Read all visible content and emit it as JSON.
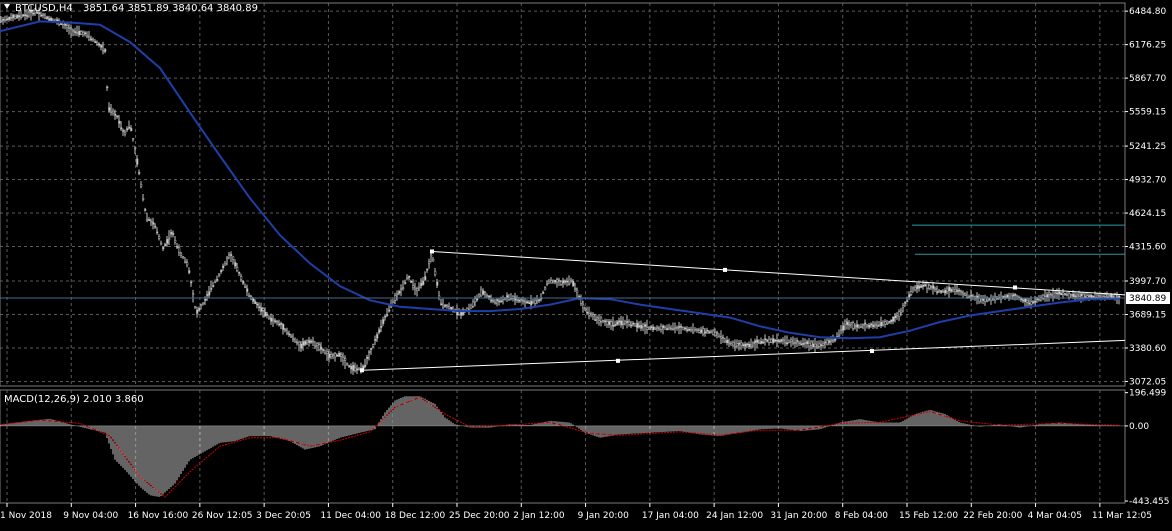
{
  "chart_data": [
    {
      "type": "candlestick",
      "title": "BTCUSD,H4",
      "ohlc_readout": "3851.64 3851.89 3840.64 3840.89",
      "symbol": "BTCUSD",
      "timeframe": "H4",
      "current_price": 3840.89,
      "current_price_label": "3840.89",
      "y_ticks": [
        "6484.80",
        "6176.25",
        "5867.70",
        "5559.15",
        "5241.25",
        "4932.70",
        "4624.15",
        "4315.60",
        "3997.70",
        "3689.15",
        "3380.60",
        "3072.05"
      ],
      "ylim": [
        3030,
        6560
      ],
      "x_ticks": [
        "1 Nov 2018",
        "9 Nov 04:00",
        "16 Nov 16:00",
        "26 Nov 12:05",
        "3 Dec 20:05",
        "11 Dec 04:00",
        "18 Dec 12:00",
        "25 Dec 20:00",
        "2 Jan 12:00",
        "9 Jan 20:00",
        "17 Jan 04:00",
        "24 Jan 12:00",
        "31 Jan 20:00",
        "8 Feb 04:00",
        "15 Feb 12:00",
        "22 Feb 20:00",
        "4 Mar 04:05",
        "11 Mar 12:05"
      ],
      "grid": true,
      "price_path": [
        [
          0,
          6400
        ],
        [
          20,
          6440
        ],
        [
          36,
          6480
        ],
        [
          48,
          6420
        ],
        [
          60,
          6380
        ],
        [
          72,
          6300
        ],
        [
          84,
          6280
        ],
        [
          96,
          6200
        ],
        [
          105,
          6120
        ],
        [
          108,
          5600
        ],
        [
          118,
          5500
        ],
        [
          124,
          5350
        ],
        [
          130,
          5450
        ],
        [
          138,
          5050
        ],
        [
          146,
          4600
        ],
        [
          155,
          4500
        ],
        [
          163,
          4300
        ],
        [
          172,
          4450
        ],
        [
          180,
          4250
        ],
        [
          188,
          4150
        ],
        [
          196,
          3700
        ],
        [
          204,
          3800
        ],
        [
          212,
          3950
        ],
        [
          222,
          4100
        ],
        [
          230,
          4250
        ],
        [
          240,
          4050
        ],
        [
          250,
          3850
        ],
        [
          260,
          3750
        ],
        [
          270,
          3650
        ],
        [
          280,
          3600
        ],
        [
          290,
          3500
        ],
        [
          300,
          3400
        ],
        [
          310,
          3450
        ],
        [
          320,
          3380
        ],
        [
          330,
          3300
        ],
        [
          340,
          3320
        ],
        [
          350,
          3200
        ],
        [
          362,
          3180
        ],
        [
          372,
          3380
        ],
        [
          382,
          3600
        ],
        [
          392,
          3800
        ],
        [
          400,
          3900
        ],
        [
          408,
          4050
        ],
        [
          416,
          3900
        ],
        [
          424,
          4000
        ],
        [
          432,
          4250
        ],
        [
          440,
          3800
        ],
        [
          450,
          3750
        ],
        [
          460,
          3700
        ],
        [
          470,
          3750
        ],
        [
          482,
          3900
        ],
        [
          495,
          3800
        ],
        [
          510,
          3850
        ],
        [
          525,
          3800
        ],
        [
          540,
          3820
        ],
        [
          548,
          4000
        ],
        [
          560,
          3980
        ],
        [
          572,
          4000
        ],
        [
          584,
          3750
        ],
        [
          596,
          3650
        ],
        [
          610,
          3600
        ],
        [
          625,
          3620
        ],
        [
          640,
          3580
        ],
        [
          655,
          3560
        ],
        [
          670,
          3570
        ],
        [
          685,
          3560
        ],
        [
          700,
          3540
        ],
        [
          715,
          3520
        ],
        [
          730,
          3420
        ],
        [
          745,
          3400
        ],
        [
          760,
          3440
        ],
        [
          775,
          3450
        ],
        [
          790,
          3440
        ],
        [
          805,
          3420
        ],
        [
          820,
          3410
        ],
        [
          835,
          3460
        ],
        [
          845,
          3600
        ],
        [
          860,
          3580
        ],
        [
          875,
          3590
        ],
        [
          890,
          3620
        ],
        [
          900,
          3700
        ],
        [
          912,
          3920
        ],
        [
          925,
          3960
        ],
        [
          940,
          3900
        ],
        [
          955,
          3920
        ],
        [
          968,
          3860
        ],
        [
          985,
          3820
        ],
        [
          1000,
          3850
        ],
        [
          1015,
          3860
        ],
        [
          1030,
          3790
        ],
        [
          1045,
          3860
        ],
        [
          1060,
          3880
        ],
        [
          1075,
          3860
        ],
        [
          1095,
          3850
        ],
        [
          1110,
          3860
        ],
        [
          1120,
          3840.89
        ]
      ],
      "ma_path": [
        [
          0,
          6300
        ],
        [
          40,
          6390
        ],
        [
          70,
          6380
        ],
        [
          100,
          6360
        ],
        [
          130,
          6200
        ],
        [
          160,
          5960
        ],
        [
          190,
          5550
        ],
        [
          220,
          5150
        ],
        [
          250,
          4760
        ],
        [
          280,
          4420
        ],
        [
          310,
          4160
        ],
        [
          340,
          3950
        ],
        [
          370,
          3820
        ],
        [
          400,
          3760
        ],
        [
          430,
          3740
        ],
        [
          460,
          3720
        ],
        [
          490,
          3720
        ],
        [
          520,
          3740
        ],
        [
          550,
          3780
        ],
        [
          580,
          3840
        ],
        [
          610,
          3830
        ],
        [
          640,
          3780
        ],
        [
          670,
          3740
        ],
        [
          700,
          3700
        ],
        [
          730,
          3660
        ],
        [
          760,
          3580
        ],
        [
          790,
          3520
        ],
        [
          820,
          3480
        ],
        [
          850,
          3470
        ],
        [
          880,
          3480
        ],
        [
          910,
          3540
        ],
        [
          940,
          3620
        ],
        [
          970,
          3680
        ],
        [
          1000,
          3720
        ],
        [
          1030,
          3760
        ],
        [
          1060,
          3800
        ],
        [
          1090,
          3830
        ],
        [
          1120,
          3835
        ]
      ],
      "trendlines": [
        {
          "name": "upper-trendline",
          "from": [
            432,
            4270
          ],
          "to": [
            1125,
            3870
          ],
          "handles": [
            [
              725,
              4100
            ],
            [
              1015,
              3938
            ]
          ]
        },
        {
          "name": "lower-trendline",
          "from": [
            362,
            3175
          ],
          "to": [
            1125,
            3450
          ],
          "handles": [
            [
              618,
              3262
            ],
            [
              872,
              3352
            ]
          ]
        }
      ],
      "horizontal_levels": [
        {
          "name": "level-line-upper",
          "price": 4513,
          "x_start": 912
        },
        {
          "name": "level-line-lower",
          "price": 4244,
          "x_start": 915
        }
      ],
      "colors": {
        "background": "#000000",
        "grid": "#5a5a5a",
        "candles": "#c8c8c8",
        "moving_average": "#1f3fa8",
        "trendline": "#ffffff",
        "level_line": "#2a9aa0",
        "price_line": "#4a6a8a",
        "axis_text": "#ffffff"
      }
    },
    {
      "type": "histogram",
      "title": "MACD(12,26,9) 2.010 3.860",
      "indicator": "MACD",
      "parameters": [
        12,
        26,
        9
      ],
      "macd_value": 2.01,
      "signal_value": 3.86,
      "y_ticks": [
        "196.499",
        "0.00",
        "-443.455"
      ],
      "ylim": [
        -455,
        212
      ],
      "macd_path": [
        [
          0,
          8
        ],
        [
          30,
          30
        ],
        [
          50,
          42
        ],
        [
          70,
          10
        ],
        [
          90,
          -20
        ],
        [
          105,
          -40
        ],
        [
          115,
          -200
        ],
        [
          125,
          -260
        ],
        [
          140,
          -360
        ],
        [
          150,
          -410
        ],
        [
          160,
          -420
        ],
        [
          175,
          -340
        ],
        [
          190,
          -200
        ],
        [
          205,
          -150
        ],
        [
          220,
          -100
        ],
        [
          235,
          -90
        ],
        [
          250,
          -60
        ],
        [
          270,
          -60
        ],
        [
          290,
          -90
        ],
        [
          305,
          -140
        ],
        [
          320,
          -120
        ],
        [
          340,
          -70
        ],
        [
          360,
          -40
        ],
        [
          375,
          -20
        ],
        [
          385,
          80
        ],
        [
          395,
          150
        ],
        [
          405,
          175
        ],
        [
          420,
          175
        ],
        [
          435,
          130
        ],
        [
          445,
          50
        ],
        [
          455,
          10
        ],
        [
          470,
          -10
        ],
        [
          490,
          -10
        ],
        [
          510,
          10
        ],
        [
          530,
          5
        ],
        [
          550,
          30
        ],
        [
          570,
          20
        ],
        [
          585,
          -40
        ],
        [
          600,
          -70
        ],
        [
          620,
          -50
        ],
        [
          650,
          -40
        ],
        [
          680,
          -30
        ],
        [
          700,
          -50
        ],
        [
          720,
          -60
        ],
        [
          740,
          -40
        ],
        [
          760,
          -20
        ],
        [
          780,
          -15
        ],
        [
          800,
          -30
        ],
        [
          820,
          -20
        ],
        [
          840,
          20
        ],
        [
          860,
          40
        ],
        [
          880,
          20
        ],
        [
          900,
          20
        ],
        [
          915,
          70
        ],
        [
          930,
          95
        ],
        [
          945,
          70
        ],
        [
          960,
          20
        ],
        [
          980,
          -5
        ],
        [
          1000,
          10
        ],
        [
          1020,
          -10
        ],
        [
          1040,
          10
        ],
        [
          1060,
          20
        ],
        [
          1080,
          10
        ],
        [
          1100,
          4
        ],
        [
          1120,
          2
        ]
      ],
      "signal_path": [
        [
          0,
          8
        ],
        [
          40,
          35
        ],
        [
          80,
          15
        ],
        [
          110,
          -60
        ],
        [
          140,
          -300
        ],
        [
          165,
          -420
        ],
        [
          190,
          -270
        ],
        [
          220,
          -120
        ],
        [
          250,
          -70
        ],
        [
          280,
          -70
        ],
        [
          310,
          -120
        ],
        [
          340,
          -85
        ],
        [
          370,
          -35
        ],
        [
          395,
          110
        ],
        [
          420,
          170
        ],
        [
          445,
          70
        ],
        [
          470,
          -5
        ],
        [
          510,
          5
        ],
        [
          550,
          22
        ],
        [
          590,
          -45
        ],
        [
          620,
          -55
        ],
        [
          680,
          -35
        ],
        [
          720,
          -55
        ],
        [
          760,
          -25
        ],
        [
          800,
          -25
        ],
        [
          840,
          15
        ],
        [
          880,
          22
        ],
        [
          930,
          85
        ],
        [
          960,
          30
        ],
        [
          1000,
          5
        ],
        [
          1060,
          15
        ],
        [
          1120,
          3.86
        ]
      ],
      "colors": {
        "histogram": "#c8c8c8",
        "signal": "#d00000",
        "zero_line": "#ffffff"
      }
    }
  ],
  "toolbar": {
    "dropdown_icon": "triangle-down-icon"
  }
}
